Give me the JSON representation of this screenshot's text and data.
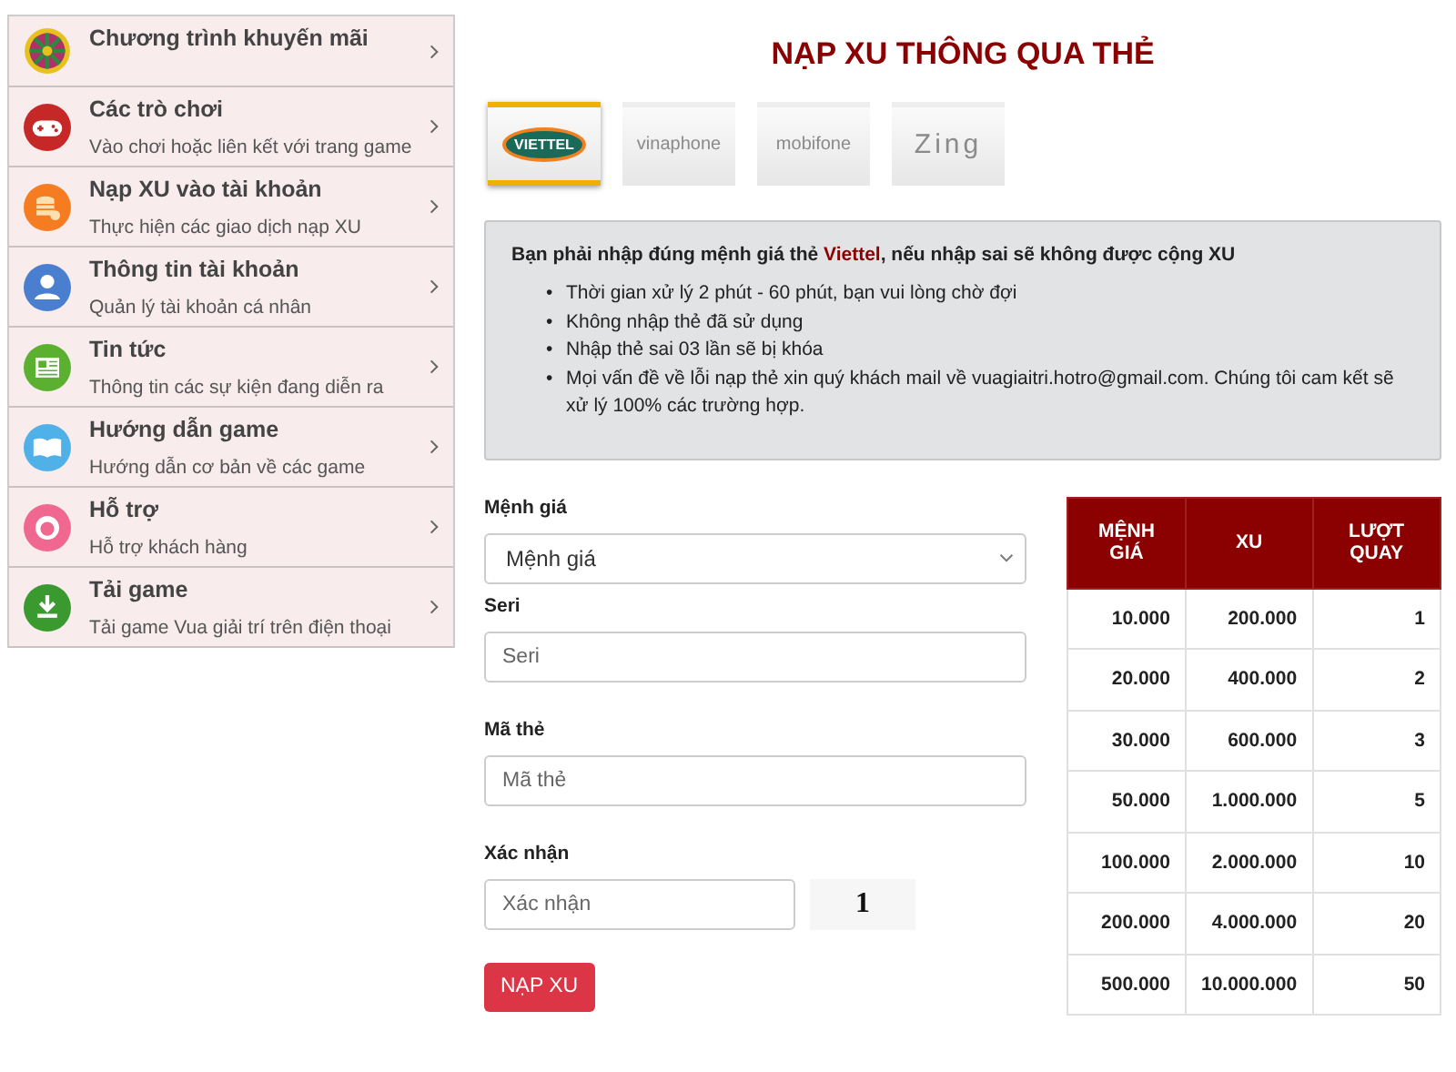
{
  "sidebar": {
    "items": [
      {
        "title": "Chương trình khuyến mãi"
      },
      {
        "title": "Các trò chơi",
        "subtitle": "Vào chơi hoặc liên kết với trang game"
      },
      {
        "title": "Nạp XU vào tài khoản",
        "subtitle": "Thực hiện các giao dịch nạp XU"
      },
      {
        "title": "Thông tin tài khoản",
        "subtitle": "Quản lý tài khoản cá nhân"
      },
      {
        "title": "Tin tức",
        "subtitle": "Thông tin các sự kiện đang diễn ra"
      },
      {
        "title": "Hướng dẫn game",
        "subtitle": "Hướng dẫn cơ bản về các game"
      },
      {
        "title": "Hỗ trợ",
        "subtitle": "Hỗ trợ khách hàng"
      },
      {
        "title": "Tải game",
        "subtitle": "Tải game Vua giải trí trên điện thoại"
      }
    ]
  },
  "title": "NẠP XU THÔNG QUA THẺ",
  "carriers": [
    {
      "label": "VIETTEL",
      "selected": true
    },
    {
      "label": "vinaphone",
      "selected": false
    },
    {
      "label": "mobifone",
      "selected": false
    },
    {
      "label": "Zing",
      "selected": false
    }
  ],
  "notice": {
    "heading": "Bạn phải nhập đúng mệnh giá thẻ **Viettel**, nếu nhập sai sẽ không được cộng XU",
    "marker": "•",
    "points": [
      "Thời gian xử lý 2 phút - 60 phút, bạn vui lòng chờ đợi",
      "Không nhập thẻ đã sử dụng",
      "Nhập thẻ sai 03 lần sẽ bị khóa",
      "Mọi vấn đề về lỗi nạp thẻ xin quý khách mail về vuagiaitri.hotro@gmail.com. Chúng tôi cam kết sẽ xử lý 100% các trường hợp."
    ]
  },
  "form": {
    "fields": [
      {
        "kind": "select",
        "label": "Mệnh giá",
        "value": "Mệnh giá"
      },
      {
        "kind": "input",
        "label": "Seri",
        "placeholder": "Seri"
      },
      {
        "kind": "input",
        "label": "Mã thẻ",
        "placeholder": "Mã thẻ"
      },
      {
        "kind": "captcha",
        "label": "Xác nhận",
        "placeholder": "Xác nhận",
        "captcha": "1"
      }
    ],
    "submit": "NẠP XU"
  },
  "table": {
    "columns": [
      "MỆNH GIÁ",
      "XU",
      "LƯỢT QUAY"
    ],
    "rows": [
      [
        "10.000",
        "200.000",
        "1"
      ],
      [
        "20.000",
        "400.000",
        "2"
      ],
      [
        "30.000",
        "600.000",
        "3"
      ],
      [
        "50.000",
        "1.000.000",
        "5"
      ],
      [
        "100.000",
        "2.000.000",
        "10"
      ],
      [
        "200.000",
        "4.000.000",
        "20"
      ],
      [
        "500.000",
        "10.000.000",
        "50"
      ]
    ]
  }
}
